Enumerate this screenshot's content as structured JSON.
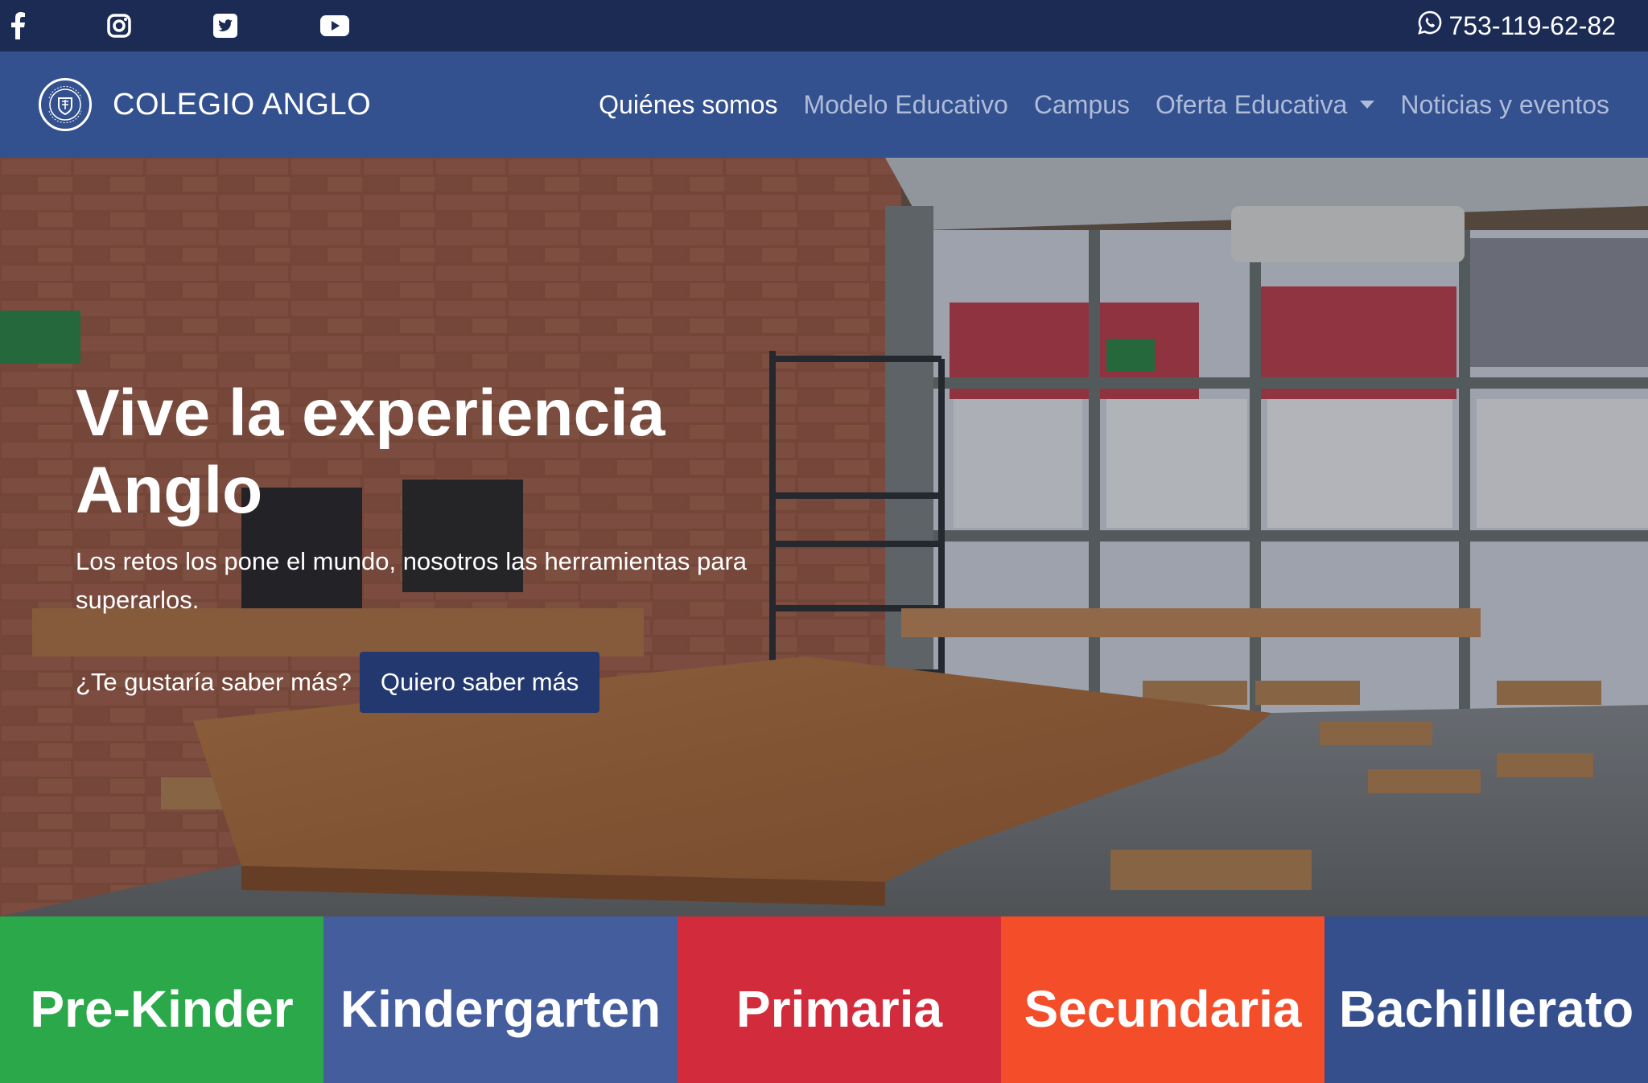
{
  "topbar": {
    "social": [
      {
        "name": "facebook-icon"
      },
      {
        "name": "instagram-icon"
      },
      {
        "name": "twitter-icon"
      },
      {
        "name": "youtube-icon"
      }
    ],
    "phone": "753-119-62-82"
  },
  "navbar": {
    "brand": "COLEGIO ANGLO",
    "items": [
      {
        "label": "Quiénes somos",
        "active": true
      },
      {
        "label": "Modelo Educativo"
      },
      {
        "label": "Campus"
      },
      {
        "label": "Oferta Educativa",
        "dropdown": true
      },
      {
        "label": "Noticias y eventos"
      }
    ]
  },
  "hero": {
    "title_line1": "Vive la experiencia",
    "title_line2": "Anglo",
    "subtitle": "Los retos los pone el mundo, nosotros las herramientas para superarlos.",
    "cta_question": "¿Te gustaría saber más?",
    "cta_button": "Quiero saber más"
  },
  "levels": [
    {
      "label": "Pre-Kinder",
      "color": "#2aa84a"
    },
    {
      "label": "Kindergarten",
      "color": "#435d9d"
    },
    {
      "label": "Primaria",
      "color": "#d22c3c"
    },
    {
      "label": "Secundaria",
      "color": "#f34d2a"
    },
    {
      "label": "Bachillerato",
      "color": "#344f8c"
    }
  ],
  "colors": {
    "topbar": "#1b2b54",
    "navbar": "#33508f",
    "cta_button": "#23386e"
  }
}
